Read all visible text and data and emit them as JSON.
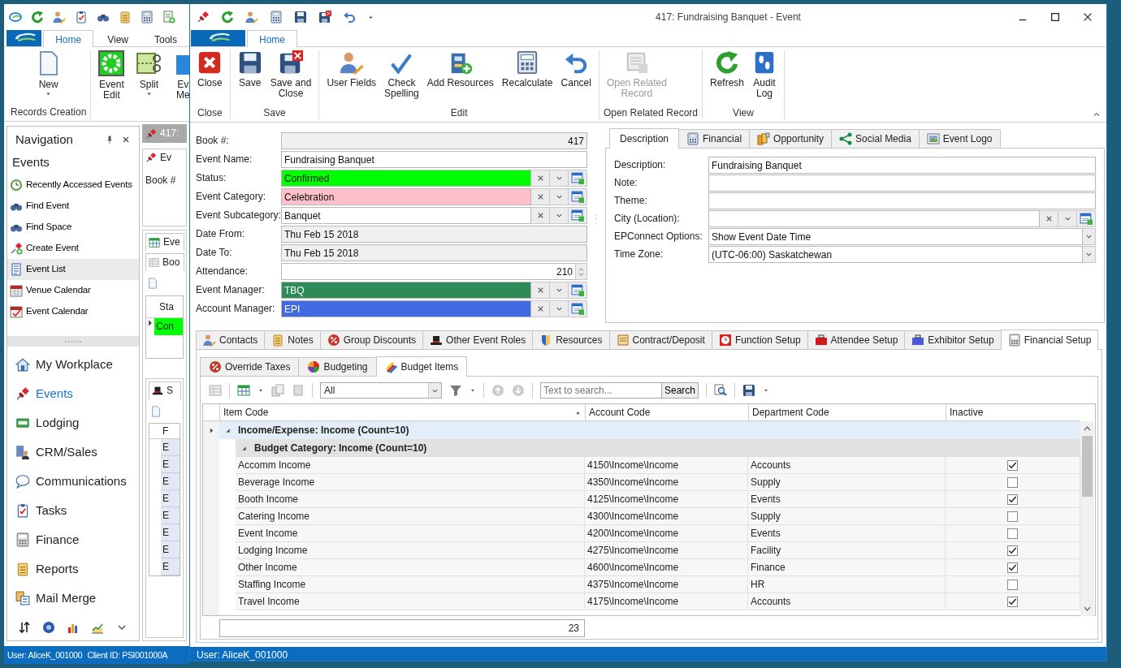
{
  "back_window": {
    "ribbon_tabs": [
      {
        "label": "Home",
        "selected": true
      },
      {
        "label": "View",
        "selected": false
      },
      {
        "label": "Tools",
        "selected": false
      }
    ],
    "ribbon_groups": [
      {
        "label": "Records Creation",
        "buttons": [
          {
            "label": [
              "New"
            ],
            "dropdown": true
          }
        ]
      },
      {
        "buttons": [
          {
            "label": [
              "Event",
              "Edit"
            ],
            "dropdown": false
          },
          {
            "label": [
              "Split"
            ],
            "dropdown": true
          },
          {
            "label": [
              "Ev",
              "Me"
            ],
            "dropdown": false
          }
        ]
      }
    ],
    "navigation": {
      "title": "Navigation",
      "section": "Events",
      "items": [
        {
          "label": "Recently Accessed Events",
          "selected": false
        },
        {
          "label": "Find Event",
          "selected": false
        },
        {
          "label": "Find Space",
          "selected": false
        },
        {
          "label": "Create Event",
          "selected": false
        },
        {
          "label": "Event List",
          "selected": true
        },
        {
          "label": "Venue Calendar",
          "selected": false
        },
        {
          "label": "Event Calendar",
          "selected": false
        }
      ],
      "modules": [
        {
          "label": "My Workplace",
          "selected": false
        },
        {
          "label": "Events",
          "selected": true
        },
        {
          "label": "Lodging",
          "selected": false
        },
        {
          "label": "CRM/Sales",
          "selected": false
        },
        {
          "label": "Communications",
          "selected": false
        },
        {
          "label": "Tasks",
          "selected": false
        },
        {
          "label": "Finance",
          "selected": false
        },
        {
          "label": "Reports",
          "selected": false
        },
        {
          "label": "Mail Merge",
          "selected": false
        }
      ]
    },
    "document_strip": {
      "tab": "417:",
      "group_title": "Ev",
      "field_label": "Book #",
      "tab_2": "Eve",
      "tab_3": "Boo",
      "column_1": "Sta",
      "cell": {
        "label": "Con",
        "color": "#00ff00"
      },
      "panel_tab": "S",
      "column_2": "F",
      "rows": [
        "E",
        "E",
        "E",
        "E",
        "E",
        "E",
        "E",
        "E"
      ]
    },
    "status_bar": [
      "User: AliceK_001000",
      "Client ID: PSI001000A"
    ]
  },
  "window": {
    "title": "417: Fundraising Banquet - Event",
    "ribbon_tabs": [
      {
        "label": "Home",
        "selected": true
      }
    ],
    "ribbon_groups": [
      {
        "label": "Close",
        "buttons": [
          {
            "label": [
              "Close"
            ],
            "disabled": false
          }
        ]
      },
      {
        "label": "Save",
        "buttons": [
          {
            "label": [
              "Save"
            ],
            "disabled": false
          },
          {
            "label": [
              "Save and",
              "Close"
            ],
            "disabled": false
          }
        ]
      },
      {
        "label": "Edit",
        "buttons": [
          {
            "label": [
              "User Fields"
            ],
            "disabled": false
          },
          {
            "label": [
              "Check",
              "Spelling"
            ],
            "disabled": false
          },
          {
            "label": [
              "Add Resources"
            ],
            "disabled": false
          },
          {
            "label": [
              "Recalculate"
            ],
            "disabled": false
          },
          {
            "label": [
              "Cancel"
            ],
            "disabled": false
          }
        ]
      },
      {
        "label": "Open Related Record",
        "buttons": [
          {
            "label": [
              "Open Related",
              "Record"
            ],
            "disabled": true
          }
        ]
      },
      {
        "label": "View",
        "buttons": [
          {
            "label": [
              "Refresh"
            ],
            "disabled": false
          },
          {
            "label": [
              "Audit",
              "Log"
            ],
            "disabled": false
          }
        ]
      }
    ],
    "form": [
      {
        "label": "Book #:",
        "kind": "readonly",
        "value": "417"
      },
      {
        "label": "Event Name:",
        "kind": "text",
        "value": "Fundraising Banquet"
      },
      {
        "label": "Status:",
        "kind": "lookup",
        "value": "Confirmed",
        "color": "#00ff00"
      },
      {
        "label": "Event Category:",
        "kind": "lookup",
        "value": "Celebration",
        "color": "#ffc0cb"
      },
      {
        "label": "Event Subcategory:",
        "kind": "lookup",
        "value": "Banquet",
        "color": "#ffffff"
      },
      {
        "label": "Date From:",
        "kind": "date",
        "value": "Thu Feb 15 2018"
      },
      {
        "label": "Date To:",
        "kind": "date",
        "value": "Thu Feb 15 2018"
      },
      {
        "label": "Attendance:",
        "kind": "spin",
        "value": "210"
      },
      {
        "label": "Event Manager:",
        "kind": "lookup",
        "value": "TBQ",
        "color": "#2e8b57"
      },
      {
        "label": "Account Manager:",
        "kind": "lookup",
        "value": "EPI",
        "color": "#4169e1"
      }
    ],
    "detail_tabs": [
      {
        "label": "Description",
        "selected": true
      },
      {
        "label": "Financial",
        "selected": false
      },
      {
        "label": "Opportunity",
        "selected": false
      },
      {
        "label": "Social Media",
        "selected": false
      },
      {
        "label": "Event Logo",
        "selected": false
      }
    ],
    "detail_fields": [
      {
        "label": "Description:",
        "kind": "text",
        "value": "Fundraising Banquet"
      },
      {
        "label": "Note:",
        "kind": "text"
      },
      {
        "label": "Theme:",
        "kind": "text"
      },
      {
        "label": "City (Location):",
        "kind": "lookup"
      },
      {
        "label": "EPConnect Options:",
        "kind": "dropdown",
        "value": "Show Event Date Time"
      },
      {
        "label": "Time Zone:",
        "kind": "dropdown",
        "value": "(UTC-06:00) Saskatchewan"
      }
    ],
    "bottom_tabs": [
      {
        "label": "Contacts",
        "selected": false
      },
      {
        "label": "Notes",
        "selected": false
      },
      {
        "label": "Group Discounts",
        "selected": false
      },
      {
        "label": "Other Event Roles",
        "selected": false
      },
      {
        "label": "Resources",
        "selected": false
      },
      {
        "label": "Contract/Deposit",
        "selected": false
      },
      {
        "label": "Function Setup",
        "selected": false
      },
      {
        "label": "Attendee Setup",
        "selected": false
      },
      {
        "label": "Exhibitor Setup",
        "selected": false
      },
      {
        "label": "Financial Setup",
        "selected": true
      }
    ],
    "sub_tabs": [
      {
        "label": "Override Taxes",
        "selected": false
      },
      {
        "label": "Budgeting",
        "selected": false
      },
      {
        "label": "Budget Items",
        "selected": true
      }
    ],
    "toolbar": {
      "filter": "All",
      "search_placeholder": "Text to search...",
      "search_button": "Search"
    },
    "grid": {
      "columns": [
        {
          "label": "Item Code",
          "sorted_ascending": true
        },
        {
          "label": "Account Code"
        },
        {
          "label": "Department Code"
        },
        {
          "label": "Inactive"
        }
      ],
      "group": "Income/Expense: Income (Count=10)",
      "subgroup": "Budget Category: Income (Count=10)",
      "rows": [
        {
          "item_code": "Accomm Income",
          "account_code": "4150\\Income\\Income",
          "department_code": "Accounts",
          "inactive": true
        },
        {
          "item_code": "Beverage Income",
          "account_code": "4350\\Income\\Income",
          "department_code": "Supply",
          "inactive": false
        },
        {
          "item_code": "Booth Income",
          "account_code": "4125\\Income\\Income",
          "department_code": "Events",
          "inactive": true
        },
        {
          "item_code": "Catering Income",
          "account_code": "4300\\Income\\Income",
          "department_code": "Supply",
          "inactive": false
        },
        {
          "item_code": "Event Income",
          "account_code": "4200\\Income\\Income",
          "department_code": "Events",
          "inactive": false
        },
        {
          "item_code": "Lodging Income",
          "account_code": "4275\\Income\\Income",
          "department_code": "Facility",
          "inactive": true
        },
        {
          "item_code": "Other Income",
          "account_code": "4600\\Income\\Income",
          "department_code": "Finance",
          "inactive": true
        },
        {
          "item_code": "Staffing Income",
          "account_code": "4375\\Income\\Income",
          "department_code": "HR",
          "inactive": false
        },
        {
          "item_code": "Travel Income",
          "account_code": "4175\\Income\\Income",
          "department_code": "Accounts",
          "inactive": true
        }
      ],
      "footer": "23"
    },
    "status_bar": "User: AliceK_001000"
  }
}
